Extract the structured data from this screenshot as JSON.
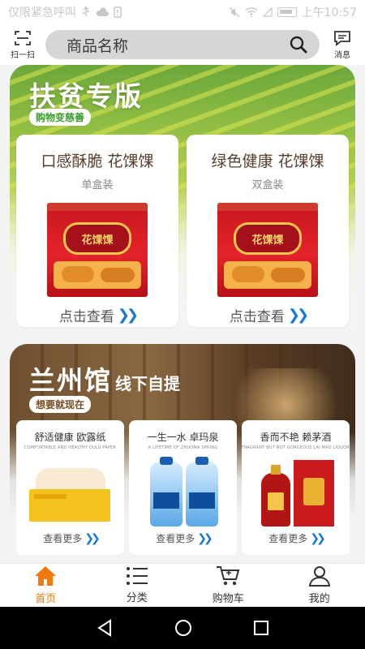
{
  "status_bar": {
    "left_text": "仅限紧急呼叫",
    "time": "上午10:57"
  },
  "header": {
    "scan_label": "扫一扫",
    "search_placeholder": "商品名称",
    "message_label": "消息"
  },
  "poverty_section": {
    "title": "扶贫专版",
    "tag": "购物变慈善",
    "cards": [
      {
        "title": "口感酥脆 花馃馃",
        "subtitle": "单盒装",
        "package_label": "花馃馃",
        "link": "点击查看"
      },
      {
        "title": "绿色健康 花馃馃",
        "subtitle": "双盒装",
        "package_label": "花馃馃",
        "link": "点击查看"
      }
    ]
  },
  "lanzhou_section": {
    "title": "兰州馆",
    "title_suffix": "线下自提",
    "tag": "想要就现在",
    "cards": [
      {
        "title": "舒适健康 欧露纸",
        "english": "COMFORTABLE AND HEALTHY OULU PAPER",
        "link": "查看更多"
      },
      {
        "title": "一生一水 卓玛泉",
        "english": "A LIFETIME OF ZHUOMA SPRING",
        "link": "查看更多"
      },
      {
        "title": "香而不艳 赖茅酒",
        "english": "FRAGRANT BUT NOT GORGEOUS LAI MAO LIQUOR",
        "link": "查看更多"
      }
    ]
  },
  "tab_bar": {
    "items": [
      {
        "label": "首页",
        "icon": "home-icon",
        "active": true
      },
      {
        "label": "分类",
        "icon": "list-icon",
        "active": false
      },
      {
        "label": "购物车",
        "icon": "cart-icon",
        "active": false
      },
      {
        "label": "我的",
        "icon": "user-icon",
        "active": false
      }
    ]
  },
  "colors": {
    "accent": "#f07a0d",
    "link_arrow": "#1976d2",
    "search_bg": "#d6d6d6"
  }
}
